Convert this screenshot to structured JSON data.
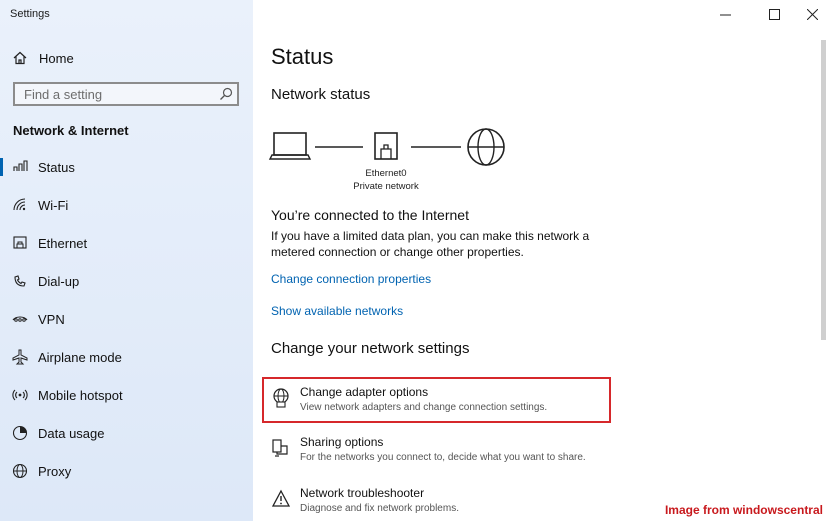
{
  "window": {
    "title": "Settings"
  },
  "sidebar": {
    "home_label": "Home",
    "search_placeholder": "Find a setting",
    "section_title": "Network & Internet",
    "items": [
      {
        "label": "Status",
        "icon": "status-icon",
        "active": true
      },
      {
        "label": "Wi-Fi",
        "icon": "wifi-icon"
      },
      {
        "label": "Ethernet",
        "icon": "ethernet-icon"
      },
      {
        "label": "Dial-up",
        "icon": "dialup-icon"
      },
      {
        "label": "VPN",
        "icon": "vpn-icon"
      },
      {
        "label": "Airplane mode",
        "icon": "airplane-icon"
      },
      {
        "label": "Mobile hotspot",
        "icon": "hotspot-icon"
      },
      {
        "label": "Data usage",
        "icon": "data-usage-icon"
      },
      {
        "label": "Proxy",
        "icon": "globe-icon"
      }
    ]
  },
  "main": {
    "title": "Status",
    "network_status_heading": "Network status",
    "adapter_name": "Ethernet0",
    "network_type": "Private network",
    "connected_heading": "You’re connected to the Internet",
    "connected_desc": "If you have a limited data plan, you can make this network a metered connection or change other properties.",
    "link_change_properties": "Change connection properties",
    "link_show_networks": "Show available networks",
    "change_settings_heading": "Change your network settings",
    "options": [
      {
        "title": "Change adapter options",
        "sub": "View network adapters and change connection settings.",
        "icon": "adapter-globe-icon"
      },
      {
        "title": "Sharing options",
        "sub": "For the networks you connect to, decide what you want to share.",
        "icon": "sharing-icon"
      },
      {
        "title": "Network troubleshooter",
        "sub": "Diagnose and fix network problems.",
        "icon": "warning-icon"
      }
    ]
  },
  "colors": {
    "accent": "#0063b1",
    "highlight": "#d6282b",
    "credit": "#c8191d"
  },
  "credit": "Image from windowscentral"
}
